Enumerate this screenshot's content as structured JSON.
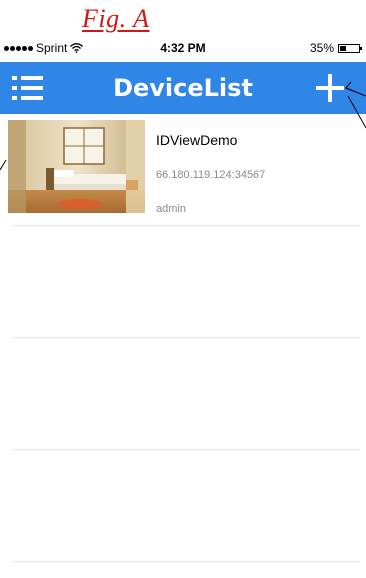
{
  "figure": {
    "label": "Fig. A"
  },
  "status_bar": {
    "carrier": "Sprint",
    "time": "4:32 PM",
    "battery_percent": "35%",
    "battery_level": 0.35,
    "signal_icon": "signal-dots-icon",
    "wifi_icon": "wifi-icon",
    "battery_icon": "battery-icon"
  },
  "nav_bar": {
    "title": "DeviceList",
    "menu_icon": "hamburger-menu-icon",
    "add_icon": "plus-icon",
    "color": "#2f86e6"
  },
  "devices": [
    {
      "name": "IDViewDemo",
      "address": "66.180.119.124:34567",
      "user": "admin",
      "thumbnail": "bedroom-camera-thumbnail"
    }
  ],
  "empty_rows": 3
}
